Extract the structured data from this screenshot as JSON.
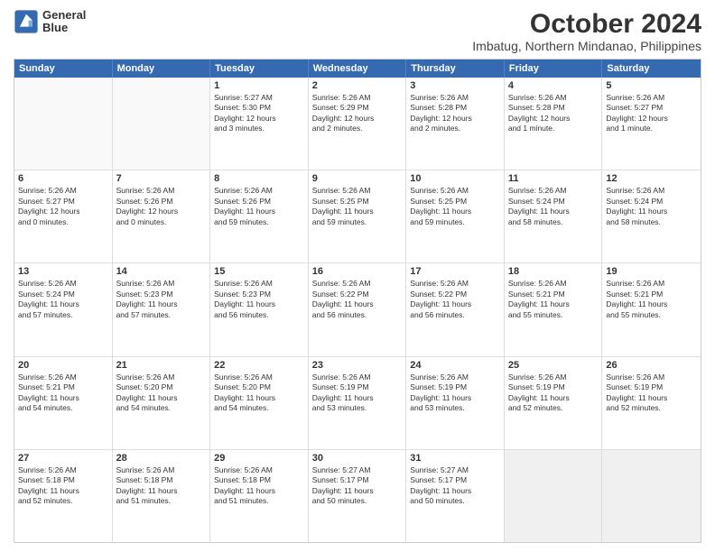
{
  "logo": {
    "line1": "General",
    "line2": "Blue"
  },
  "header": {
    "month": "October 2024",
    "location": "Imbatug, Northern Mindanao, Philippines"
  },
  "weekdays": [
    "Sunday",
    "Monday",
    "Tuesday",
    "Wednesday",
    "Thursday",
    "Friday",
    "Saturday"
  ],
  "rows": [
    [
      {
        "day": "",
        "text": "",
        "empty": true
      },
      {
        "day": "",
        "text": "",
        "empty": true
      },
      {
        "day": "1",
        "text": "Sunrise: 5:27 AM\nSunset: 5:30 PM\nDaylight: 12 hours\nand 3 minutes."
      },
      {
        "day": "2",
        "text": "Sunrise: 5:26 AM\nSunset: 5:29 PM\nDaylight: 12 hours\nand 2 minutes."
      },
      {
        "day": "3",
        "text": "Sunrise: 5:26 AM\nSunset: 5:28 PM\nDaylight: 12 hours\nand 2 minutes."
      },
      {
        "day": "4",
        "text": "Sunrise: 5:26 AM\nSunset: 5:28 PM\nDaylight: 12 hours\nand 1 minute."
      },
      {
        "day": "5",
        "text": "Sunrise: 5:26 AM\nSunset: 5:27 PM\nDaylight: 12 hours\nand 1 minute."
      }
    ],
    [
      {
        "day": "6",
        "text": "Sunrise: 5:26 AM\nSunset: 5:27 PM\nDaylight: 12 hours\nand 0 minutes."
      },
      {
        "day": "7",
        "text": "Sunrise: 5:26 AM\nSunset: 5:26 PM\nDaylight: 12 hours\nand 0 minutes."
      },
      {
        "day": "8",
        "text": "Sunrise: 5:26 AM\nSunset: 5:26 PM\nDaylight: 11 hours\nand 59 minutes."
      },
      {
        "day": "9",
        "text": "Sunrise: 5:26 AM\nSunset: 5:25 PM\nDaylight: 11 hours\nand 59 minutes."
      },
      {
        "day": "10",
        "text": "Sunrise: 5:26 AM\nSunset: 5:25 PM\nDaylight: 11 hours\nand 59 minutes."
      },
      {
        "day": "11",
        "text": "Sunrise: 5:26 AM\nSunset: 5:24 PM\nDaylight: 11 hours\nand 58 minutes."
      },
      {
        "day": "12",
        "text": "Sunrise: 5:26 AM\nSunset: 5:24 PM\nDaylight: 11 hours\nand 58 minutes."
      }
    ],
    [
      {
        "day": "13",
        "text": "Sunrise: 5:26 AM\nSunset: 5:24 PM\nDaylight: 11 hours\nand 57 minutes."
      },
      {
        "day": "14",
        "text": "Sunrise: 5:26 AM\nSunset: 5:23 PM\nDaylight: 11 hours\nand 57 minutes."
      },
      {
        "day": "15",
        "text": "Sunrise: 5:26 AM\nSunset: 5:23 PM\nDaylight: 11 hours\nand 56 minutes."
      },
      {
        "day": "16",
        "text": "Sunrise: 5:26 AM\nSunset: 5:22 PM\nDaylight: 11 hours\nand 56 minutes."
      },
      {
        "day": "17",
        "text": "Sunrise: 5:26 AM\nSunset: 5:22 PM\nDaylight: 11 hours\nand 56 minutes."
      },
      {
        "day": "18",
        "text": "Sunrise: 5:26 AM\nSunset: 5:21 PM\nDaylight: 11 hours\nand 55 minutes."
      },
      {
        "day": "19",
        "text": "Sunrise: 5:26 AM\nSunset: 5:21 PM\nDaylight: 11 hours\nand 55 minutes."
      }
    ],
    [
      {
        "day": "20",
        "text": "Sunrise: 5:26 AM\nSunset: 5:21 PM\nDaylight: 11 hours\nand 54 minutes."
      },
      {
        "day": "21",
        "text": "Sunrise: 5:26 AM\nSunset: 5:20 PM\nDaylight: 11 hours\nand 54 minutes."
      },
      {
        "day": "22",
        "text": "Sunrise: 5:26 AM\nSunset: 5:20 PM\nDaylight: 11 hours\nand 54 minutes."
      },
      {
        "day": "23",
        "text": "Sunrise: 5:26 AM\nSunset: 5:19 PM\nDaylight: 11 hours\nand 53 minutes."
      },
      {
        "day": "24",
        "text": "Sunrise: 5:26 AM\nSunset: 5:19 PM\nDaylight: 11 hours\nand 53 minutes."
      },
      {
        "day": "25",
        "text": "Sunrise: 5:26 AM\nSunset: 5:19 PM\nDaylight: 11 hours\nand 52 minutes."
      },
      {
        "day": "26",
        "text": "Sunrise: 5:26 AM\nSunset: 5:19 PM\nDaylight: 11 hours\nand 52 minutes."
      }
    ],
    [
      {
        "day": "27",
        "text": "Sunrise: 5:26 AM\nSunset: 5:18 PM\nDaylight: 11 hours\nand 52 minutes."
      },
      {
        "day": "28",
        "text": "Sunrise: 5:26 AM\nSunset: 5:18 PM\nDaylight: 11 hours\nand 51 minutes."
      },
      {
        "day": "29",
        "text": "Sunrise: 5:26 AM\nSunset: 5:18 PM\nDaylight: 11 hours\nand 51 minutes."
      },
      {
        "day": "30",
        "text": "Sunrise: 5:27 AM\nSunset: 5:17 PM\nDaylight: 11 hours\nand 50 minutes."
      },
      {
        "day": "31",
        "text": "Sunrise: 5:27 AM\nSunset: 5:17 PM\nDaylight: 11 hours\nand 50 minutes."
      },
      {
        "day": "",
        "text": "",
        "empty": true,
        "shaded": true
      },
      {
        "day": "",
        "text": "",
        "empty": true,
        "shaded": true
      }
    ]
  ]
}
